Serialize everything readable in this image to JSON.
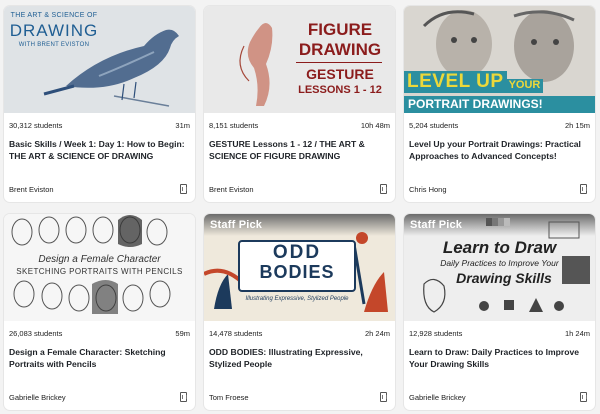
{
  "cards": [
    {
      "students": "30,312 students",
      "duration": "31m",
      "title": "Basic Skills / Week 1: Day 1: How to Begin: THE ART & SCIENCE OF DRAWING",
      "author": "Brent Eviston",
      "staff_pick": "",
      "thumb": {
        "line1": "THE ART & SCIENCE OF",
        "line2": "DRAWING",
        "line3": "WITH BRENT EVISTON",
        "bg": "#dfe3e6",
        "accent": "#1f5e93"
      }
    },
    {
      "students": "8,151 students",
      "duration": "10h 48m",
      "title": "GESTURE Lessons 1 - 12 / THE ART & SCIENCE OF FIGURE DRAWING",
      "author": "Brent Eviston",
      "staff_pick": "",
      "thumb": {
        "line1": "FIGURE",
        "line2": "DRAWING",
        "line3": "GESTURE",
        "line4": "LESSONS 1 - 12",
        "bg": "#e9e9e9",
        "accent": "#8b1c1c"
      }
    },
    {
      "students": "5,204 students",
      "duration": "2h 15m",
      "title": "Level Up your Portrait Drawings: Practical Approaches to Advanced Concepts!",
      "author": "Chris Hong",
      "staff_pick": "",
      "thumb": {
        "line1": "LEVEL UP",
        "line1b": "YOUR",
        "line2": "PORTRAIT DRAWINGS!",
        "bg": "#d9d6d0",
        "accent": "#2b8fa0",
        "accent2": "#ecd83a"
      }
    },
    {
      "students": "26,083 students",
      "duration": "59m",
      "title": "Design a Female Character: Sketching Portraits with Pencils",
      "author": "Gabrielle Brickey",
      "staff_pick": "",
      "thumb": {
        "line1": "Design a Female Character",
        "line2": "SKETCHING PORTRAITS WITH PENCILS",
        "bg": "#f6f6f6"
      }
    },
    {
      "students": "14,478 students",
      "duration": "2h 24m",
      "title": "ODD BODIES: Illustrating Expressive, Stylized People",
      "author": "Tom Froese",
      "staff_pick": "Staff Pick",
      "thumb": {
        "line1": "ODD",
        "line2": "BODIES",
        "line3": "Illustrating Expressive, Stylized People",
        "bg": "#efe9dc",
        "accent": "#1c3a5c"
      }
    },
    {
      "students": "12,928 students",
      "duration": "1h 24m",
      "title": "Learn to Draw: Daily Practices to Improve Your Drawing Skills",
      "author": "Gabrielle Brickey",
      "staff_pick": "Staff Pick",
      "thumb": {
        "line1": "Learn to Draw",
        "line2": "Daily Practices to Improve Your",
        "line3": "Drawing Skills",
        "bg": "#eeeeee"
      }
    }
  ]
}
